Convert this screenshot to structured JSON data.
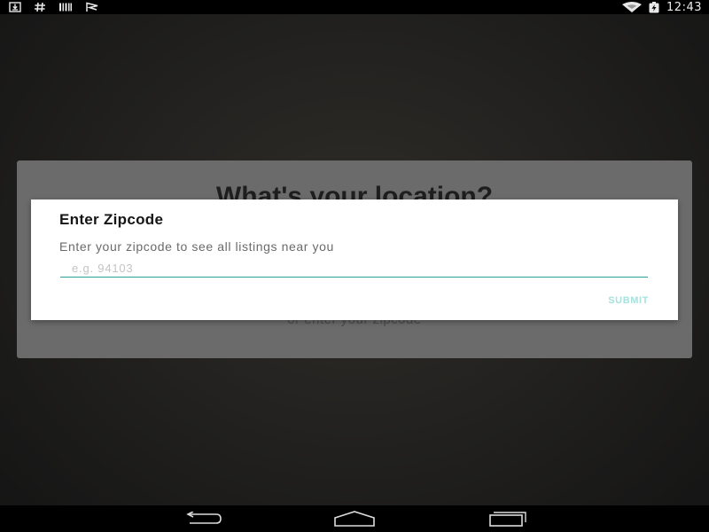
{
  "status_bar": {
    "time": "12:43",
    "left_icons": [
      "download-icon",
      "hash-icon",
      "barcode-icon",
      "flag-icon"
    ],
    "right_icons": [
      "wifi-icon",
      "battery-charging-icon"
    ]
  },
  "background": {
    "title": "What's your location?",
    "subtext": "or enter your zipcode"
  },
  "dialog": {
    "title": "Enter Zipcode",
    "message": "Enter your zipcode to see all listings near you",
    "input": {
      "value": "",
      "placeholder": "e.g. 94103"
    },
    "submit_label": "SUBMIT",
    "accent_color": "#2aa198"
  },
  "nav_bar": {
    "buttons": [
      "back-icon",
      "home-icon",
      "recent-apps-icon"
    ]
  }
}
